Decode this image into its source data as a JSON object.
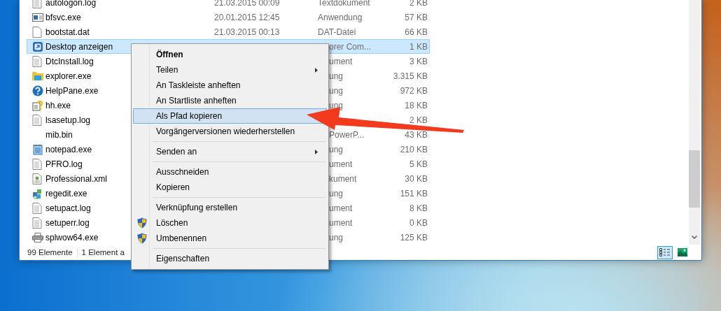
{
  "files": [
    {
      "name": "autologon.log",
      "date": "21.03.2015 00:09",
      "type": "Textdokument",
      "size": "2 KB",
      "kind": "text",
      "selected": false,
      "covered": false
    },
    {
      "name": "bfsvc.exe",
      "date": "20.01.2015 12:45",
      "type": "Anwendung",
      "size": "57 KB",
      "kind": "app",
      "selected": false,
      "covered": false
    },
    {
      "name": "bootstat.dat",
      "date": "21.03.2015 00:13",
      "type": "DAT-Datei",
      "size": "66 KB",
      "kind": "blank",
      "selected": false,
      "covered": false
    },
    {
      "name": "Desktop anzeigen",
      "type": "orer Com...",
      "size": "1 KB",
      "kind": "shortcut",
      "selected": true,
      "covered": true
    },
    {
      "name": "DtcInstall.log",
      "type": "ument",
      "size": "3 KB",
      "kind": "text",
      "selected": false,
      "covered": true
    },
    {
      "name": "explorer.exe",
      "type": "ung",
      "size": "3.315 KB",
      "kind": "folder",
      "selected": false,
      "covered": true
    },
    {
      "name": "HelpPane.exe",
      "type": "ung",
      "size": "972 KB",
      "kind": "help",
      "selected": false,
      "covered": true
    },
    {
      "name": "hh.exe",
      "type": "ung",
      "size": "18 KB",
      "kind": "helpdoc",
      "selected": false,
      "covered": true
    },
    {
      "name": "lsasetup.log",
      "size": "2 KB",
      "kind": "text",
      "selected": false
    },
    {
      "name": "mib.bin",
      "type": "PowerP...",
      "size": "43 KB",
      "kind": "none",
      "selected": false,
      "covered": true
    },
    {
      "name": "notepad.exe",
      "type": "ung",
      "size": "210 KB",
      "kind": "notepad",
      "selected": false,
      "covered": true
    },
    {
      "name": "PFRO.log",
      "type": "ument",
      "size": "5 KB",
      "kind": "text",
      "selected": false,
      "covered": true
    },
    {
      "name": "Professional.xml",
      "type": "kument",
      "size": "30 KB",
      "kind": "xml",
      "selected": false,
      "covered": true
    },
    {
      "name": "regedit.exe",
      "type": "ung",
      "size": "151 KB",
      "kind": "regedit",
      "selected": false,
      "covered": true
    },
    {
      "name": "setupact.log",
      "type": "ument",
      "size": "8 KB",
      "kind": "text",
      "selected": false,
      "covered": true
    },
    {
      "name": "setuperr.log",
      "type": "ument",
      "size": "0 KB",
      "kind": "text",
      "selected": false,
      "covered": true
    },
    {
      "name": "splwow64.exe",
      "type": "ung",
      "size": "125 KB",
      "kind": "printer",
      "selected": false,
      "covered": true
    }
  ],
  "status_bar": {
    "count": "99 Elemente",
    "selection": "1 Element a"
  },
  "view_buttons": [
    {
      "kind": "details",
      "selected": true
    },
    {
      "kind": "tiles",
      "selected": false
    }
  ],
  "context_menu": [
    {
      "kind": "item",
      "label": "Öffnen",
      "default": true,
      "submenu": false,
      "shield": false,
      "selected": false
    },
    {
      "kind": "item",
      "label": "Teilen",
      "default": false,
      "submenu": true,
      "shield": false,
      "selected": false
    },
    {
      "kind": "item",
      "label": "An Taskleiste anheften",
      "default": false,
      "submenu": false,
      "shield": false,
      "selected": false
    },
    {
      "kind": "item",
      "label": "An Startliste anheften",
      "default": false,
      "submenu": false,
      "shield": false,
      "selected": false
    },
    {
      "kind": "item",
      "label": "Als Pfad kopieren",
      "default": false,
      "submenu": false,
      "shield": false,
      "selected": true
    },
    {
      "kind": "item",
      "label": "Vorgängerversionen wiederherstellen",
      "default": false,
      "submenu": false,
      "shield": false,
      "selected": false
    },
    {
      "kind": "separator"
    },
    {
      "kind": "item",
      "label": "Senden an",
      "default": false,
      "submenu": true,
      "shield": false,
      "selected": false
    },
    {
      "kind": "separator"
    },
    {
      "kind": "item",
      "label": "Ausschneiden",
      "default": false,
      "submenu": false,
      "shield": false,
      "selected": false
    },
    {
      "kind": "item",
      "label": "Kopieren",
      "default": false,
      "submenu": false,
      "shield": false,
      "selected": false
    },
    {
      "kind": "separator"
    },
    {
      "kind": "item",
      "label": "Verknüpfung erstellen",
      "default": false,
      "submenu": false,
      "shield": false,
      "selected": false
    },
    {
      "kind": "item",
      "label": "Löschen",
      "default": false,
      "submenu": false,
      "shield": true,
      "selected": false
    },
    {
      "kind": "item",
      "label": "Umbenennen",
      "default": false,
      "submenu": false,
      "shield": true,
      "selected": false
    },
    {
      "kind": "separator"
    },
    {
      "kind": "item",
      "label": "Eigenschaften",
      "default": false,
      "submenu": false,
      "shield": false,
      "selected": false
    }
  ]
}
